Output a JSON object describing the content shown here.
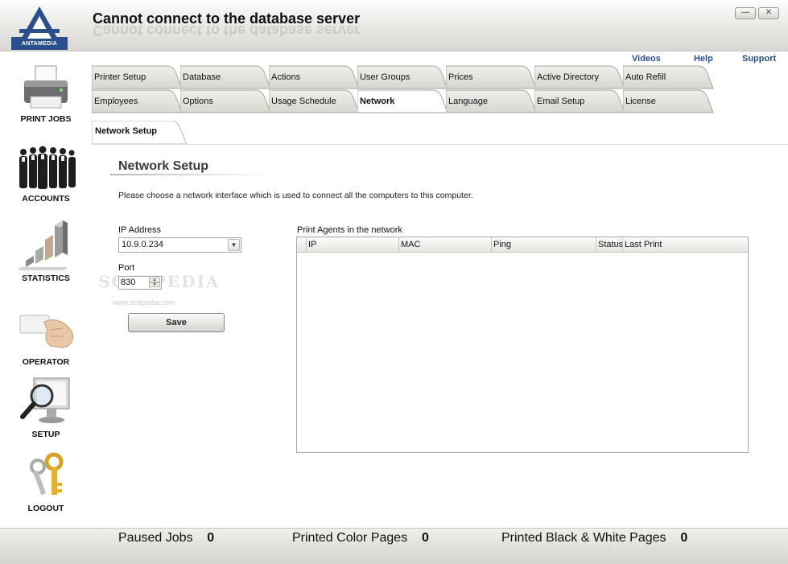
{
  "header": {
    "logo_text": "ANTAMEDIA",
    "title": "Cannot connect to the database server",
    "minimize_icon": "minimize-icon",
    "close_icon": "close-icon"
  },
  "links": {
    "videos": "Videos",
    "help": "Help",
    "support": "Support"
  },
  "sidebar": {
    "items": [
      {
        "label": "PRINT JOBS",
        "icon": "printer-icon"
      },
      {
        "label": "ACCOUNTS",
        "icon": "people-icon"
      },
      {
        "label": "STATISTICS",
        "icon": "bar-chart-icon"
      },
      {
        "label": "OPERATOR",
        "icon": "card-hand-icon"
      },
      {
        "label": "SETUP",
        "icon": "magnifier-monitor-icon"
      },
      {
        "label": "LOGOUT",
        "icon": "keys-icon"
      }
    ]
  },
  "tabs": {
    "row1": [
      "Printer Setup",
      "Database",
      "Actions",
      "User Groups",
      "Prices",
      "Active Directory",
      "Auto Refill"
    ],
    "row2": [
      "Employees",
      "Options",
      "Usage Schedule",
      "Network",
      "Language",
      "Email Setup",
      "License"
    ],
    "active": "Network"
  },
  "subtab": "Network Setup",
  "section": {
    "title": "Network Setup",
    "instructions": "Please choose a network interface which is used to connect all the computers to this computer."
  },
  "form": {
    "ip_label": "IP Address",
    "ip_value": "10.9.0.234",
    "port_label": "Port",
    "port_value": "830",
    "save_label": "Save"
  },
  "agents": {
    "title": "Print Agents in the network",
    "columns": [
      "IP",
      "MAC",
      "Ping",
      "Status",
      "Last Print"
    ],
    "rows": []
  },
  "watermark": {
    "text": "SOFTPEDIA",
    "url": "www.softpedia.com"
  },
  "footer": {
    "paused_label": "Paused Jobs",
    "paused_value": "0",
    "color_label": "Printed Color Pages",
    "color_value": "0",
    "bw_label": "Printed Black & White Pages",
    "bw_value": "0"
  },
  "colors": {
    "link": "#2a4e8c",
    "tab_fill": "#d8d6d0",
    "active_tab_fill": "#ffffff"
  }
}
